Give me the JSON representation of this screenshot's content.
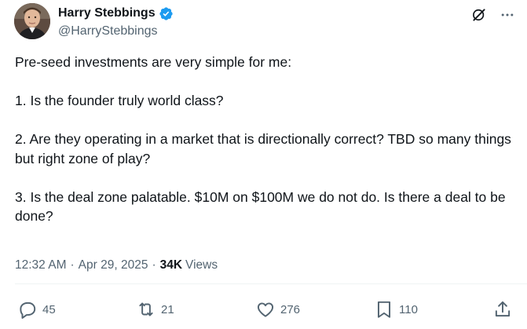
{
  "author": {
    "display_name": "Harry Stebbings",
    "handle": "@HarryStebbings",
    "verified_icon": "verified-badge-icon"
  },
  "top_actions": {
    "grok_icon": "grok-icon",
    "more_icon": "more-icon"
  },
  "tweet": {
    "text": "Pre-seed investments are very simple for me:\n\n1. Is the founder truly world class?\n\n2. Are they operating in a market that is directionally correct? TBD so many things but right zone of play?\n\n3. Is the deal zone palatable. $10M on $100M we do not do. Is there a deal to be done?"
  },
  "meta": {
    "time": "12:32 AM",
    "separator": "·",
    "date": "Apr 29, 2025",
    "views_count": "34K",
    "views_label": "Views"
  },
  "engagement": {
    "replies": "45",
    "reposts": "21",
    "likes": "276",
    "bookmarks": "110"
  },
  "colors": {
    "text": "#0f1419",
    "secondary": "#536471",
    "verified": "#1d9bf0",
    "divider": "#eff3f4"
  }
}
